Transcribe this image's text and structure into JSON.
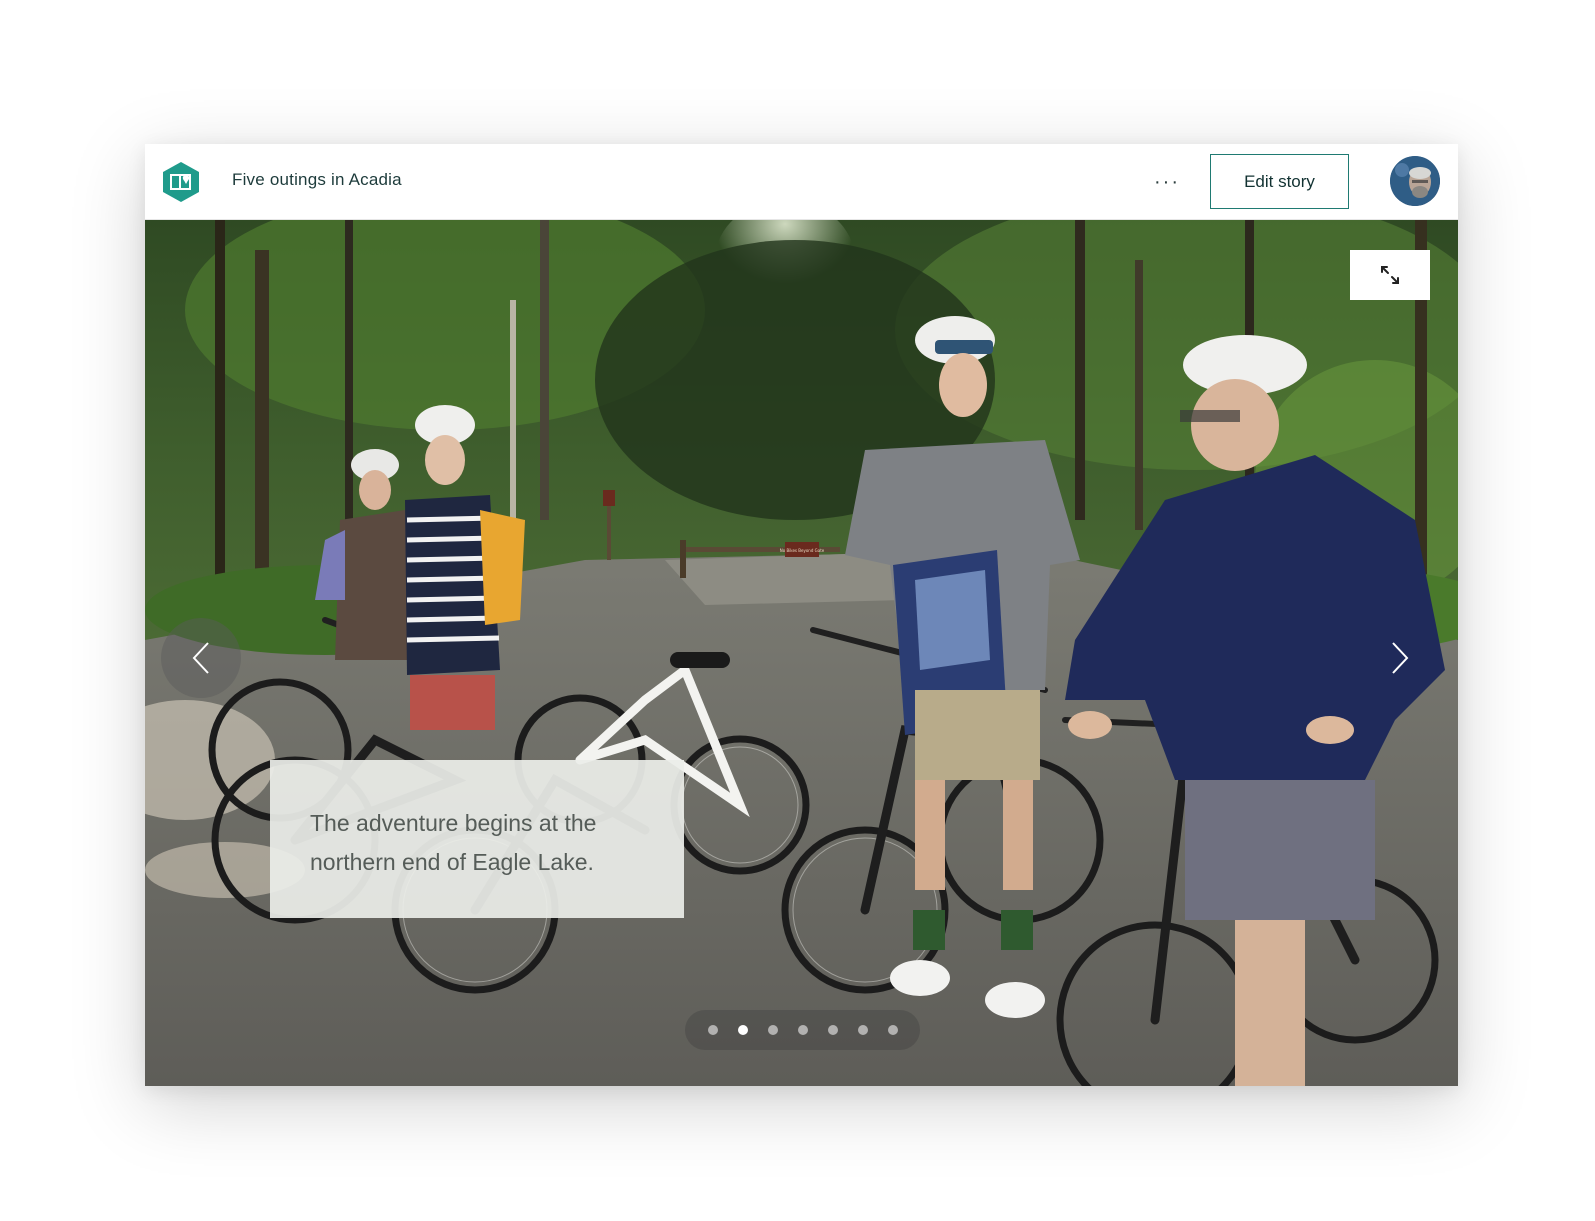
{
  "header": {
    "story_title": "Five outings in Acadia",
    "more_label": "···",
    "edit_label": "Edit story"
  },
  "slide": {
    "caption": "The adventure begins at the northern end of Eagle Lake.",
    "sign_text": "No Bikes Beyond Gate"
  },
  "pager": {
    "total": 7,
    "active_index": 1
  },
  "colors": {
    "brand_teal": "#1f9b8b",
    "button_border": "#1f7a72",
    "title_text": "#1d3b3b"
  },
  "icons": {
    "logo": "story-map-icon",
    "more": "more-options-icon",
    "expand": "expand-icon",
    "prev": "chevron-left-icon",
    "next": "chevron-right-icon"
  }
}
